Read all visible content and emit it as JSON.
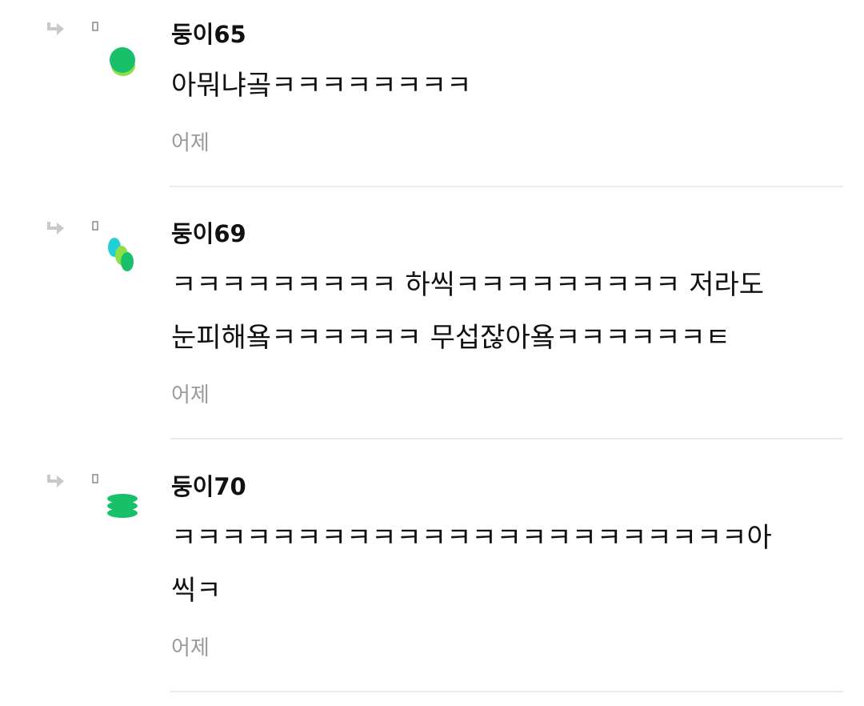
{
  "comments": [
    {
      "author": "둥이65",
      "text": "아뭐냐곸ㅋㅋㅋㅋㅋㅋㅋㅋ",
      "time": "어제"
    },
    {
      "author": "둥이69",
      "text": "ㅋㅋㅋㅋㅋㅋㅋㅋㅋ 하씩ㅋㅋㅋㅋㅋㅋㅋㅋㅋ 저라도\n눈피해욬ㅋㅋㅋㅋㅋㅋ 무섭잖아욬ㅋㅋㅋㅋㅋㅋㅌ",
      "time": "어제"
    },
    {
      "author": "둥이70",
      "text": "ㅋㅋㅋㅋㅋㅋㅋㅋㅋㅋㅋㅋㅋㅋㅋㅋㅋㅋㅋㅋㅋㅋㅋ아\n씩ㅋ",
      "time": "어제"
    }
  ],
  "icons": {
    "reply": "reply-arrow-icon",
    "placeholder": "rect-icon"
  },
  "colors": {
    "green": "#19c06a",
    "lime": "#8ee04a",
    "cyan": "#23cfd6",
    "time": "#9a9a9a",
    "divider": "#ebebeb"
  }
}
